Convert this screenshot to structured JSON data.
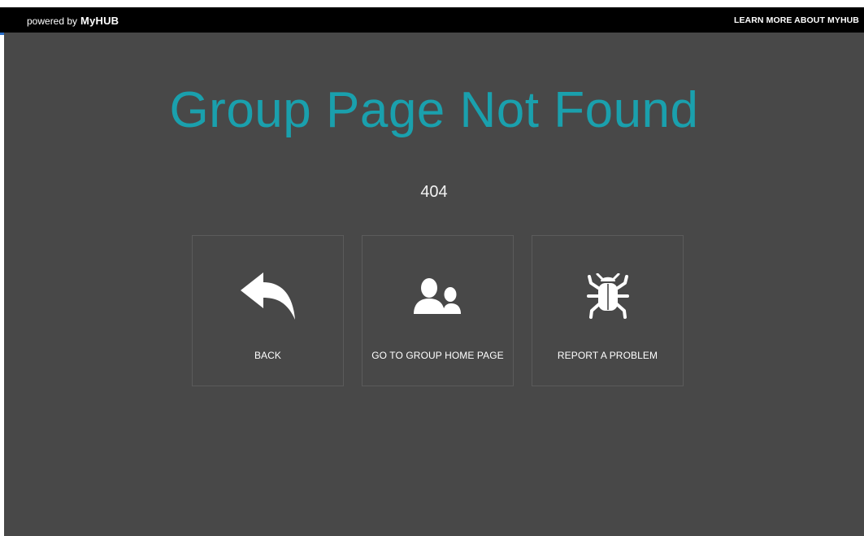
{
  "topbar": {
    "powered_prefix": "powered by",
    "powered_brand": "MyHUB",
    "learn_more": "LEARN MORE ABOUT MYHUB"
  },
  "page": {
    "title": "Group Page Not Found",
    "error_code": "404"
  },
  "actions": [
    {
      "label": "BACK",
      "icon": "back-arrow-icon"
    },
    {
      "label": "GO TO GROUP HOME PAGE",
      "icon": "group-users-icon"
    },
    {
      "label": "REPORT A PROBLEM",
      "icon": "bug-icon"
    }
  ],
  "colors": {
    "title": "#1aa0ad",
    "background": "#484848",
    "topbar": "#000000",
    "accent": "#2a6fc9"
  }
}
